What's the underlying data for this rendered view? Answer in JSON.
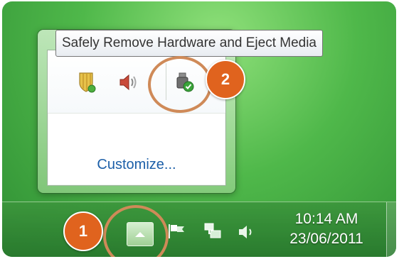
{
  "tooltip": {
    "text": "Safely Remove Hardware and Eject Media"
  },
  "popup": {
    "icons": [
      "windows-action-center-icon",
      "volume-icon",
      "safely-remove-hardware-icon"
    ],
    "customize_label": "Customize..."
  },
  "callouts": [
    {
      "label": "1"
    },
    {
      "label": "2"
    }
  ],
  "taskbar": {
    "tray_icons": [
      "show-hidden-icons-button",
      "action-center-flag-icon",
      "network-icon",
      "volume-icon"
    ],
    "time": "10:14 AM",
    "date": "23/06/2011"
  },
  "colors": {
    "callout_fill": "#e0631e",
    "highlight_ring": "#cf8a58",
    "link_blue": "#1c5fa8",
    "taskbar_green": "#3c963c"
  }
}
